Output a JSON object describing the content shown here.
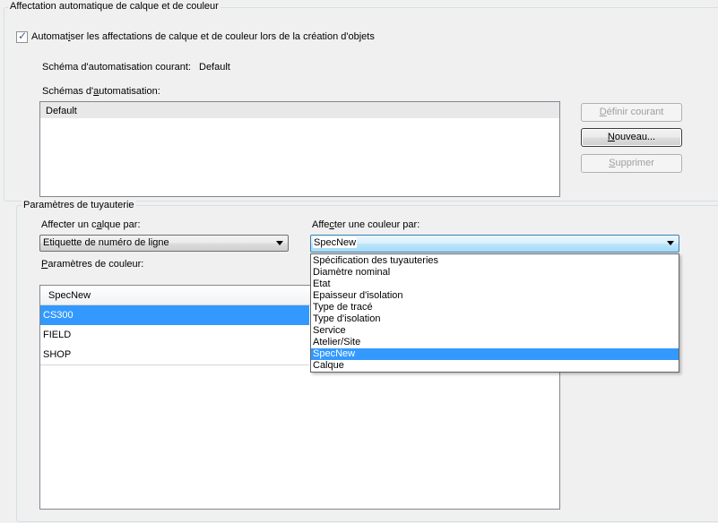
{
  "auto_assign_group": {
    "legend": "Affectation automatique de calque et de couleur",
    "checkbox_label_pre": "Automat",
    "checkbox_label_ul": "i",
    "checkbox_label_post": "ser les affectations de calque et de couleur lors de la création d'objets",
    "checkbox_checked": true,
    "current_scheme_label": "Schéma d'automatisation courant:",
    "current_scheme_value": "Default",
    "schemes_label_pre": "Schémas d'",
    "schemes_label_ul": "a",
    "schemes_label_post": "utomatisation:",
    "schemes": [
      "Default"
    ],
    "buttons": {
      "set_current_pre": "",
      "set_current_ul": "D",
      "set_current_post": "éfinir courant",
      "new_pre": "",
      "new_ul": "N",
      "new_post": "ouveau...",
      "delete_pre": "",
      "delete_ul": "S",
      "delete_post": "upprimer"
    }
  },
  "piping_group": {
    "legend": "Paramètres de tuyauterie",
    "layer_label_pre": "Affecter un c",
    "layer_label_ul": "a",
    "layer_label_post": "lque par:",
    "layer_value": "Etiquette de numéro de ligne",
    "color_label_pre": "Affe",
    "color_label_ul": "c",
    "color_label_post": "ter une couleur par:",
    "color_value": "SpecNew",
    "color_params_label_pre": "",
    "color_params_label_ul": "P",
    "color_params_label_post": "aramètres de couleur:",
    "color_table_header": "SpecNew",
    "color_rows": [
      "CS300",
      "FIELD",
      "SHOP"
    ],
    "selected_row": "CS300"
  },
  "color_dropdown_options": [
    "Spécification des tuyauteries",
    "Diamètre nominal",
    "Etat",
    "Epaisseur d'isolation",
    "Type de tracé",
    "Type d'isolation",
    "Service",
    "Atelier/Site",
    "SpecNew",
    "Calque"
  ],
  "selected_option": "SpecNew",
  "colors": {
    "selection": "#3399ff",
    "window_bg": "#f0f0f0"
  }
}
